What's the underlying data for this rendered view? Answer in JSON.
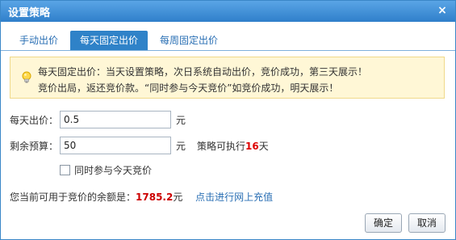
{
  "dialog": {
    "title": "设置策略",
    "close_glyph": "×"
  },
  "tabs": [
    {
      "label": "手动出价",
      "active": false
    },
    {
      "label": "每天固定出价",
      "active": true
    },
    {
      "label": "每周固定出价",
      "active": false
    }
  ],
  "notice": {
    "line1": "每天固定出价：当天设置策略，次日系统自动出价，竞价成功，第三天展示！",
    "line2": "竞价出局，返还竞价款。“同时参与今天竞价”如竞价成功，明天展示！"
  },
  "form": {
    "daily_bid_label": "每天出价：",
    "daily_bid_value": "0.5",
    "daily_bid_unit": "元",
    "budget_label": "剩余预算：",
    "budget_value": "50",
    "budget_unit": "元",
    "exec_prefix": "策略可执行",
    "exec_days": "16",
    "exec_suffix": "天",
    "join_today_label": "同时参与今天竞价",
    "join_today_checked": false
  },
  "balance": {
    "prefix": "您当前可用于竞价的余额是：",
    "amount": "1785.2",
    "unit": "元",
    "recharge_link": "点击进行网上充值"
  },
  "buttons": {
    "confirm": "确定",
    "cancel": "取消"
  },
  "colors": {
    "titlebar": "#2f7fca",
    "tab_active": "#2f82c8",
    "link": "#2a6fb4",
    "highlight_red": "#d00000",
    "notice_bg": "#fff7d6"
  },
  "icons": {
    "notice": "lightbulb-icon",
    "close": "close-icon"
  }
}
